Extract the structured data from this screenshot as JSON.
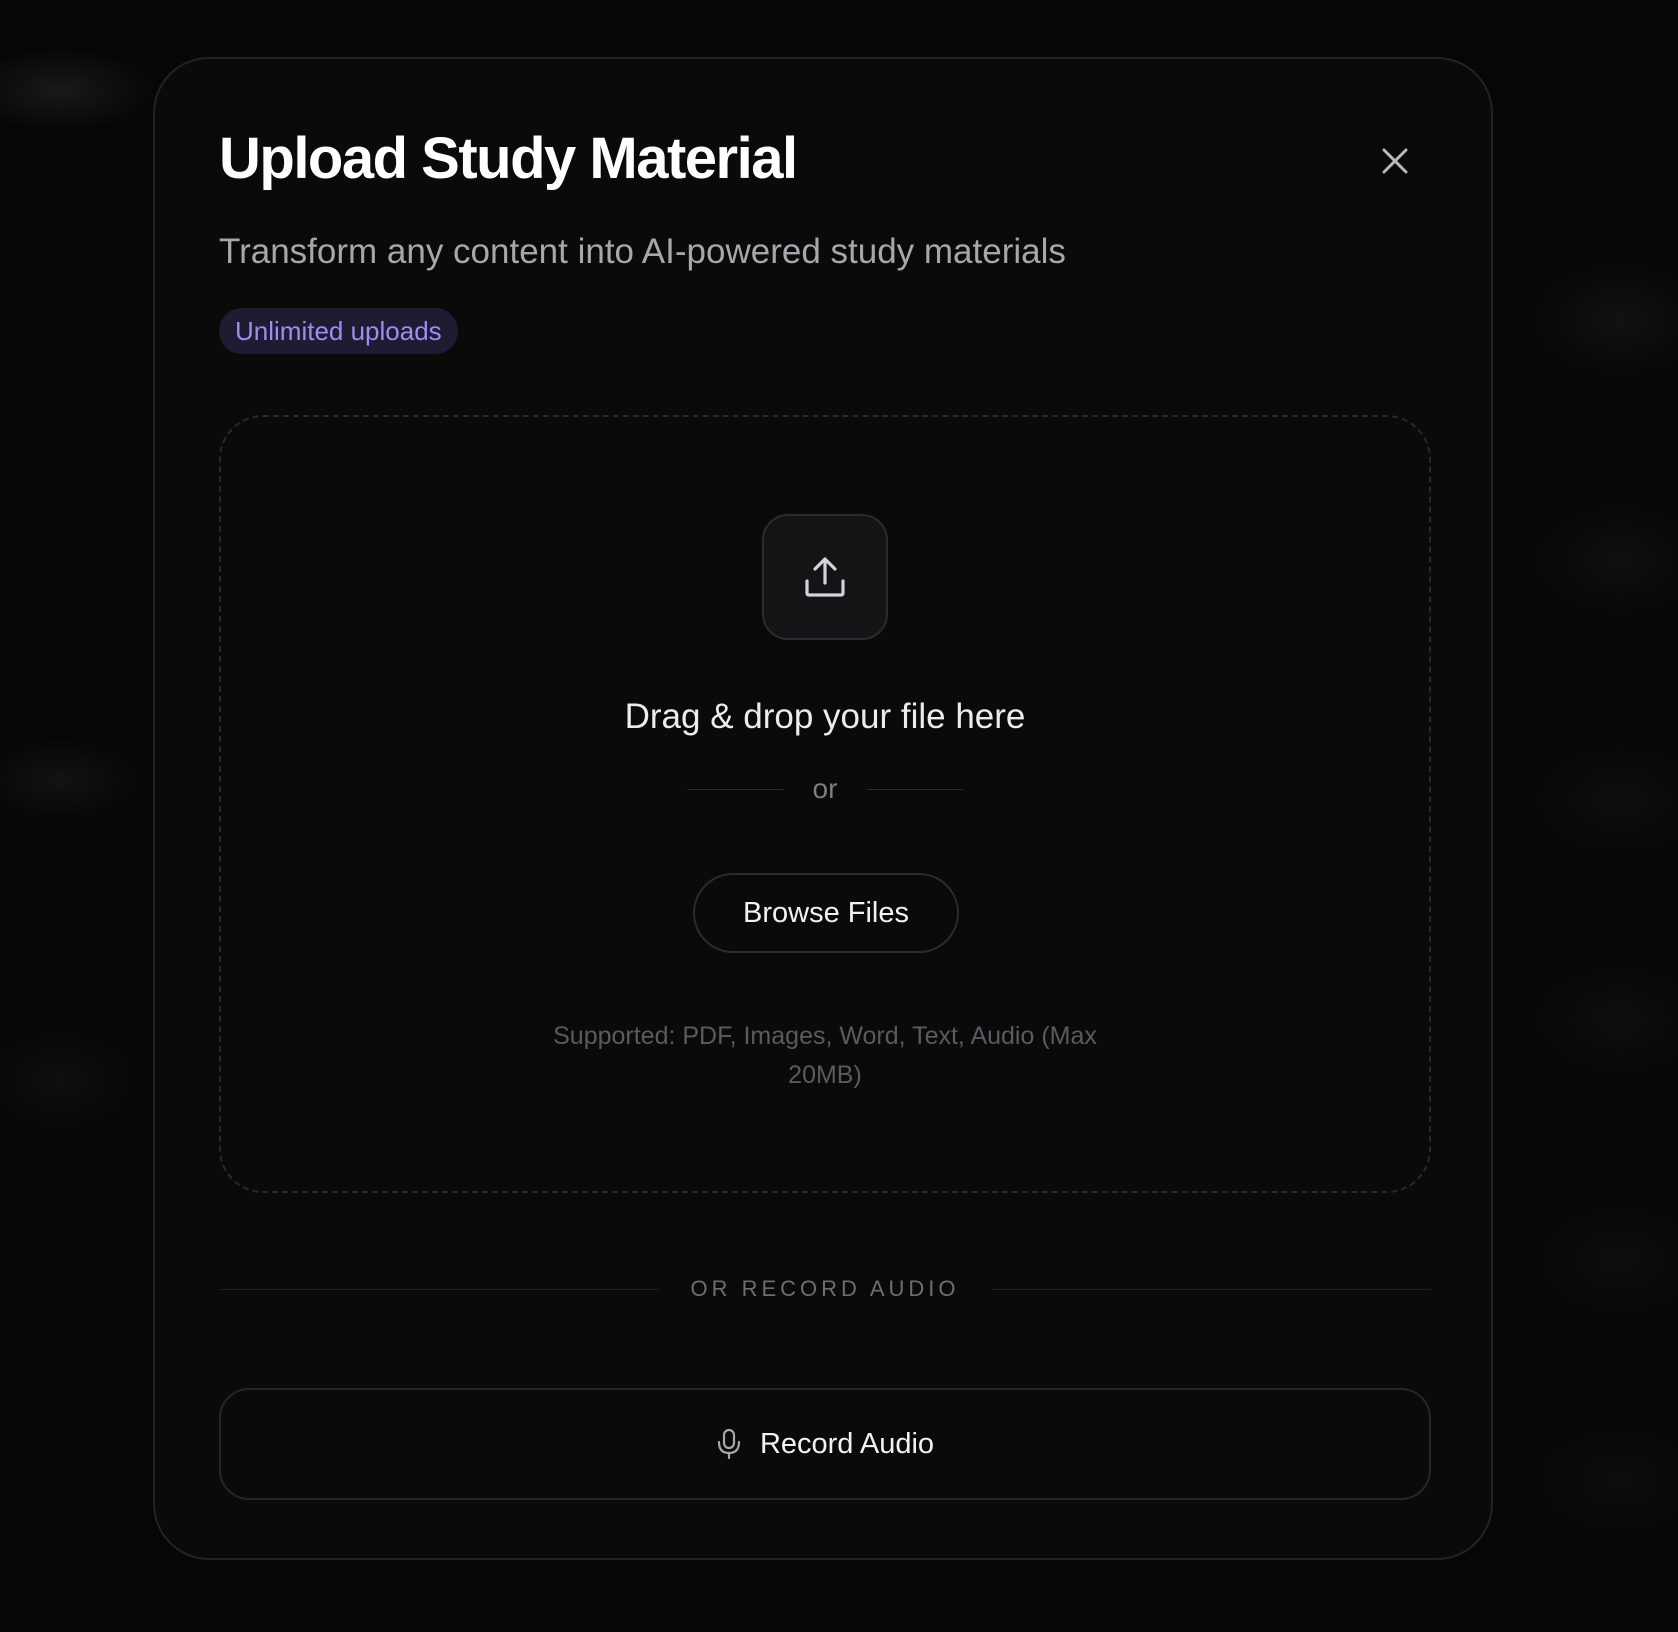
{
  "modal": {
    "title": "Upload Study Material",
    "subtitle": "Transform any content into AI-powered study materials",
    "badge": "Unlimited uploads",
    "close_icon": "close-icon"
  },
  "dropzone": {
    "icon": "upload-icon",
    "heading": "Drag & drop your file here",
    "or_label": "or",
    "browse_label": "Browse Files",
    "supported_text": "Supported: PDF, Images, Word, Text, Audio (Max 20MB)"
  },
  "record": {
    "divider_label": "OR RECORD AUDIO",
    "button_label": "Record Audio",
    "icon": "microphone-icon"
  },
  "colors": {
    "background": "#060607",
    "modal_bg": "#0a0a0b",
    "badge_bg": "#1e1b33",
    "badge_text": "#a08cf0",
    "primary_text": "#ffffff",
    "secondary_text": "#a6a6ab"
  }
}
